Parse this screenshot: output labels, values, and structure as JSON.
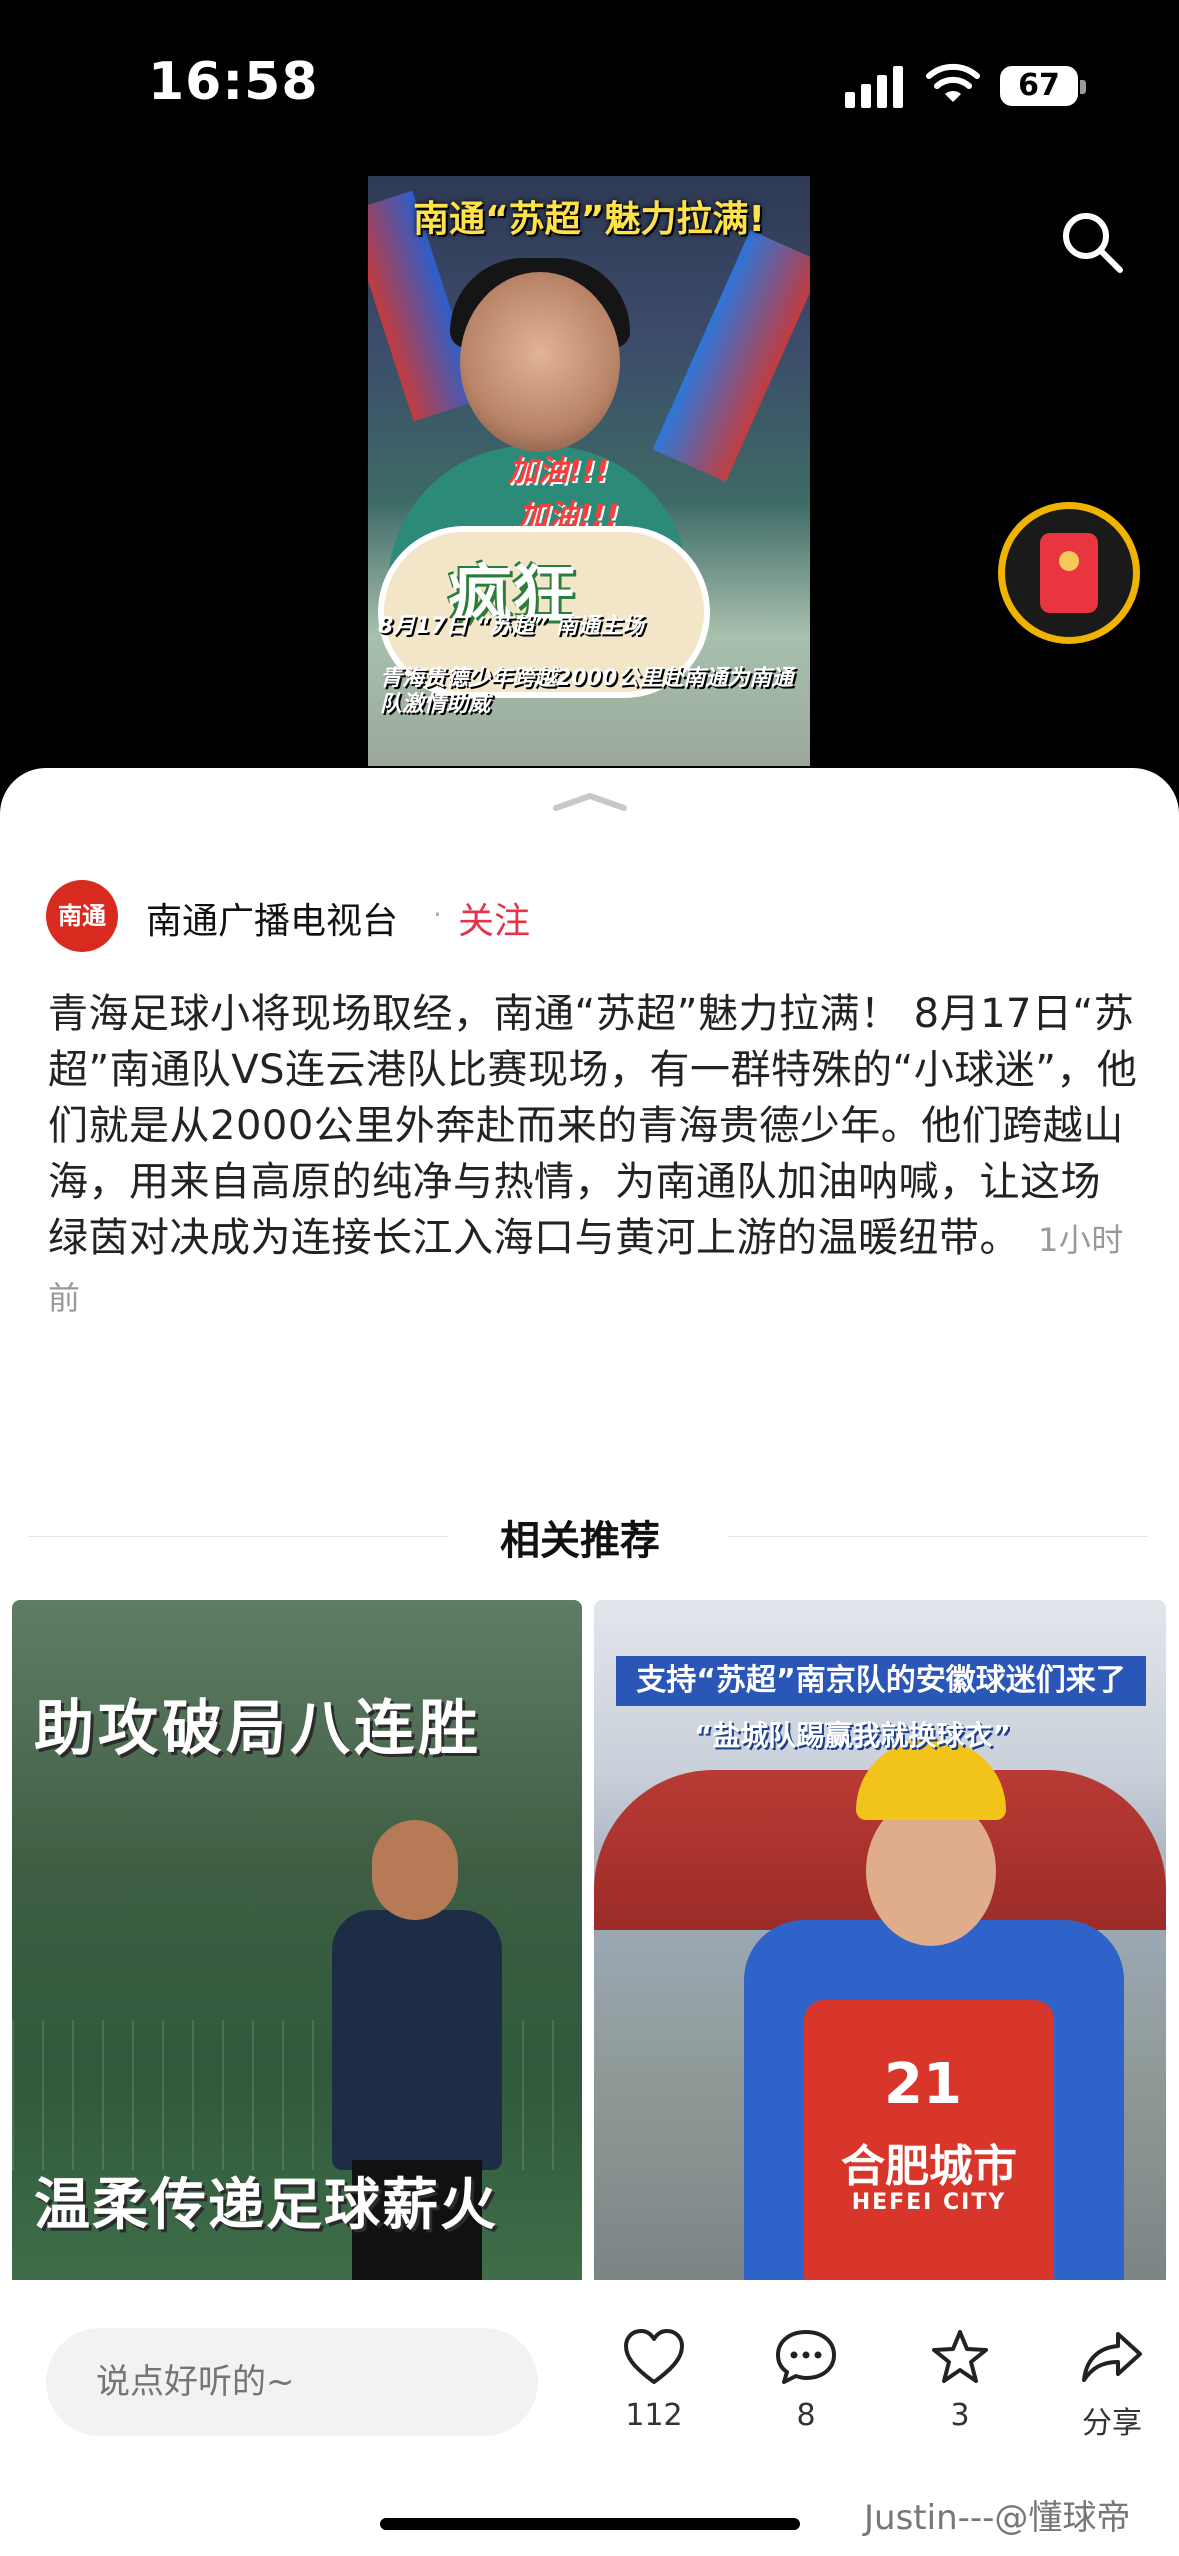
{
  "status_bar": {
    "time": "16:58",
    "battery": "67"
  },
  "video": {
    "headline": "南通“苏超”魅力拉满!",
    "cheer": "加油!!!",
    "badge_text": "疯狂",
    "date_line": "8月17日 “苏超” 南通主场",
    "caption": "青海贵德少年跨越2000公里赴南通为南通队激情助威"
  },
  "author": {
    "avatar_text": "南通",
    "name": "南通广播电视台",
    "follow_label": "关注"
  },
  "post": {
    "text": "青海足球小将现场取经，南通“苏超”魅力拉满！ 8月17日“苏超”南通队VS连云港队比赛现场，有一群特殊的“小球迷”，他们就是从2000公里外奔赴而来的青海贵德少年。他们跨越山海，用来自高原的纯净与热情，为南通队加油呐喊，让这场绿茵对决成为连接长江入海口与黄河上游的温暖纽带。",
    "time_ago": "1小时前"
  },
  "related": {
    "title": "相关推荐",
    "card1": {
      "top_text": "助攻破局八连胜",
      "bottom_text": "温柔传递足球薪火"
    },
    "card2": {
      "banner": "支持“苏超”南京队的安徽球迷们来了",
      "subtitle": "“盐城队踢赢我就换球衣”",
      "jersey_number": "21",
      "jersey_team": "合肥城市",
      "jersey_city": "HEFEI CITY"
    }
  },
  "bottom_bar": {
    "comment_placeholder": "说点好听的~",
    "likes": "112",
    "comments": "8",
    "favorites": "3",
    "share_label": "分享"
  },
  "watermark": "Justin---@懂球帝"
}
